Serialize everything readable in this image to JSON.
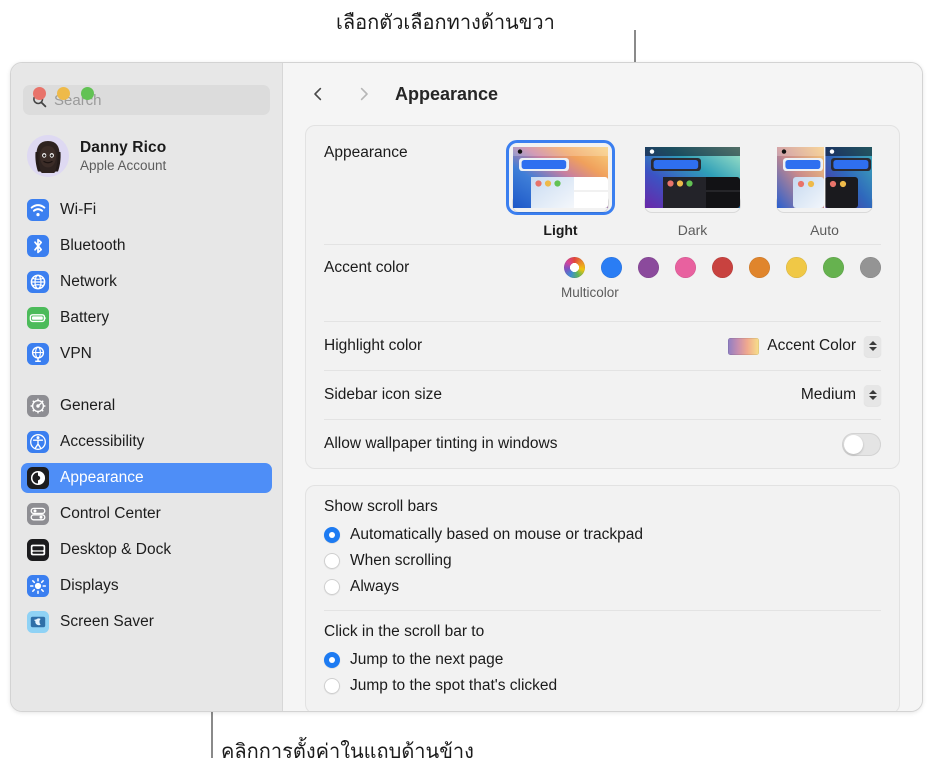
{
  "callouts": {
    "top": "เลือกตัวเลือกทางด้านขวา",
    "bottom": "คลิกการตั้งค่าในแถบด้านข้าง"
  },
  "window": {
    "traffic_lights": [
      {
        "name": "close",
        "color": "#e8736a"
      },
      {
        "name": "minimize",
        "color": "#eeba4a"
      },
      {
        "name": "zoom",
        "color": "#62c254"
      }
    ]
  },
  "sidebar": {
    "search": {
      "placeholder": "Search",
      "value": "",
      "icon": "search-icon"
    },
    "account": {
      "name": "Danny Rico",
      "subtitle": "Apple Account",
      "avatar": "memoji-avatar"
    },
    "groups": [
      {
        "items": [
          {
            "label": "Wi-Fi",
            "icon": "wifi-icon",
            "icon_bg": "#3b7ff0",
            "selected": false
          },
          {
            "label": "Bluetooth",
            "icon": "bluetooth-icon",
            "icon_bg": "#3b7ff0",
            "selected": false
          },
          {
            "label": "Network",
            "icon": "globe-icon",
            "icon_bg": "#3b7ff0",
            "selected": false
          },
          {
            "label": "Battery",
            "icon": "battery-icon",
            "icon_bg": "#4cbb5a",
            "selected": false
          },
          {
            "label": "VPN",
            "icon": "vpn-globe-icon",
            "icon_bg": "#3b7ff0",
            "selected": false
          }
        ]
      },
      {
        "items": [
          {
            "label": "General",
            "icon": "gear-icon",
            "icon_bg": "#8e8e93",
            "selected": false
          },
          {
            "label": "Accessibility",
            "icon": "accessibility-icon",
            "icon_bg": "#3b7ff0",
            "selected": false
          },
          {
            "label": "Appearance",
            "icon": "appearance-icon",
            "icon_bg": "#1c1c1e",
            "selected": true
          },
          {
            "label": "Control Center",
            "icon": "control-center-icon",
            "icon_bg": "#8e8e93",
            "selected": false
          },
          {
            "label": "Desktop & Dock",
            "icon": "desktop-dock-icon",
            "icon_bg": "#1c1c1e",
            "selected": false
          },
          {
            "label": "Displays",
            "icon": "brightness-icon",
            "icon_bg": "#3b7ff0",
            "selected": false
          },
          {
            "label": "Screen Saver",
            "icon": "screen-saver-icon",
            "icon_bg": "#8fd2f5",
            "selected": false
          }
        ]
      }
    ]
  },
  "toolbar": {
    "back_icon": "chevron-left-icon",
    "forward_icon": "chevron-right-icon",
    "title": "Appearance"
  },
  "main": {
    "appearance": {
      "label": "Appearance",
      "options": [
        {
          "name": "Light",
          "selected": true
        },
        {
          "name": "Dark",
          "selected": false
        },
        {
          "name": "Auto",
          "selected": false
        }
      ]
    },
    "accent_color": {
      "label": "Accent color",
      "caption": "Multicolor",
      "swatches": [
        {
          "name": "Multicolor",
          "color": "multicolor",
          "selected": true
        },
        {
          "name": "Blue",
          "color": "#2a7df4"
        },
        {
          "name": "Purple",
          "color": "#8b4a9c"
        },
        {
          "name": "Pink",
          "color": "#e8619f"
        },
        {
          "name": "Red",
          "color": "#c8423f"
        },
        {
          "name": "Orange",
          "color": "#e0852c"
        },
        {
          "name": "Yellow",
          "color": "#f0c846"
        },
        {
          "name": "Green",
          "color": "#66b24f"
        },
        {
          "name": "Graphite",
          "color": "#949494"
        }
      ]
    },
    "highlight_color": {
      "label": "Highlight color",
      "value": "Accent Color"
    },
    "sidebar_icon_size": {
      "label": "Sidebar icon size",
      "value": "Medium"
    },
    "wallpaper_tinting": {
      "label": "Allow wallpaper tinting in windows",
      "enabled": false
    },
    "show_scroll_bars": {
      "title": "Show scroll bars",
      "options": [
        {
          "label": "Automatically based on mouse or trackpad",
          "selected": true
        },
        {
          "label": "When scrolling",
          "selected": false
        },
        {
          "label": "Always",
          "selected": false
        }
      ]
    },
    "click_scroll_bar": {
      "title": "Click in the scroll bar to",
      "options": [
        {
          "label": "Jump to the next page",
          "selected": true
        },
        {
          "label": "Jump to the spot that's clicked",
          "selected": false
        }
      ]
    }
  }
}
